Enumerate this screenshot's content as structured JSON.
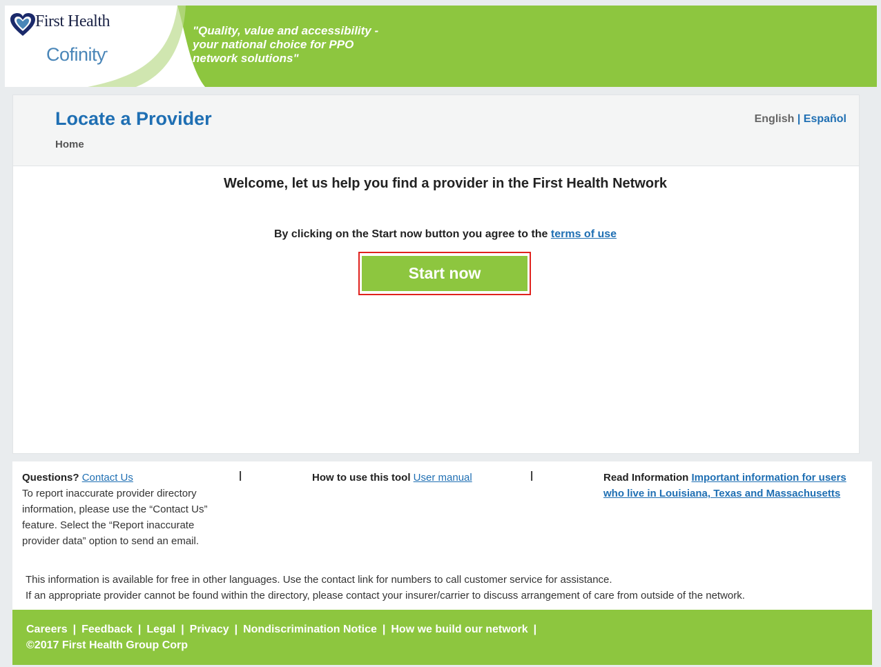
{
  "header": {
    "logo_text": "First Health",
    "logo_sub": "Cofinity",
    "tagline_lines": [
      "\"Quality, value and accessibility -",
      "your national choice for PPO",
      "network solutions\""
    ]
  },
  "title_bar": {
    "title": "Locate a Provider",
    "breadcrumb": "Home",
    "lang_english": "English",
    "lang_sep": "|",
    "lang_spanish": "Español"
  },
  "main": {
    "welcome": "Welcome, let us help you find a provider in the First Health Network",
    "agree_text": "By clicking on the Start now button you agree to the",
    "terms_link": "terms of use",
    "start_button": "Start now"
  },
  "info": {
    "questions_label": "Questions?",
    "contact_link": "Contact Us",
    "questions_body": "To report inaccurate provider directory information, please use the “Contact Us” feature. Select the “Report inaccurate provider data” option to send an email.",
    "how_label": "How to use this tool",
    "manual_link": "User manual",
    "read_label": "Read Information",
    "important_link": "Important information for users who live in Louisiana, Texas and Massachusetts",
    "pipe": "|",
    "notice1": "This information is available for free in other languages. Use the contact link for numbers to call customer service for assistance.",
    "notice2": "If an appropriate provider cannot be found within the directory, please contact your insurer/carrier to discuss arrangement of care from outside of the network."
  },
  "footer": {
    "links": [
      "Careers",
      "Feedback",
      "Legal",
      "Privacy",
      "Nondiscrimination Notice",
      "How we build our network"
    ],
    "sep": "|",
    "copyright": "©2017 First Health Group Corp"
  },
  "colors": {
    "brand_green": "#8dc63f",
    "link_blue": "#1f6fb3",
    "highlight_red": "#e0211d"
  }
}
